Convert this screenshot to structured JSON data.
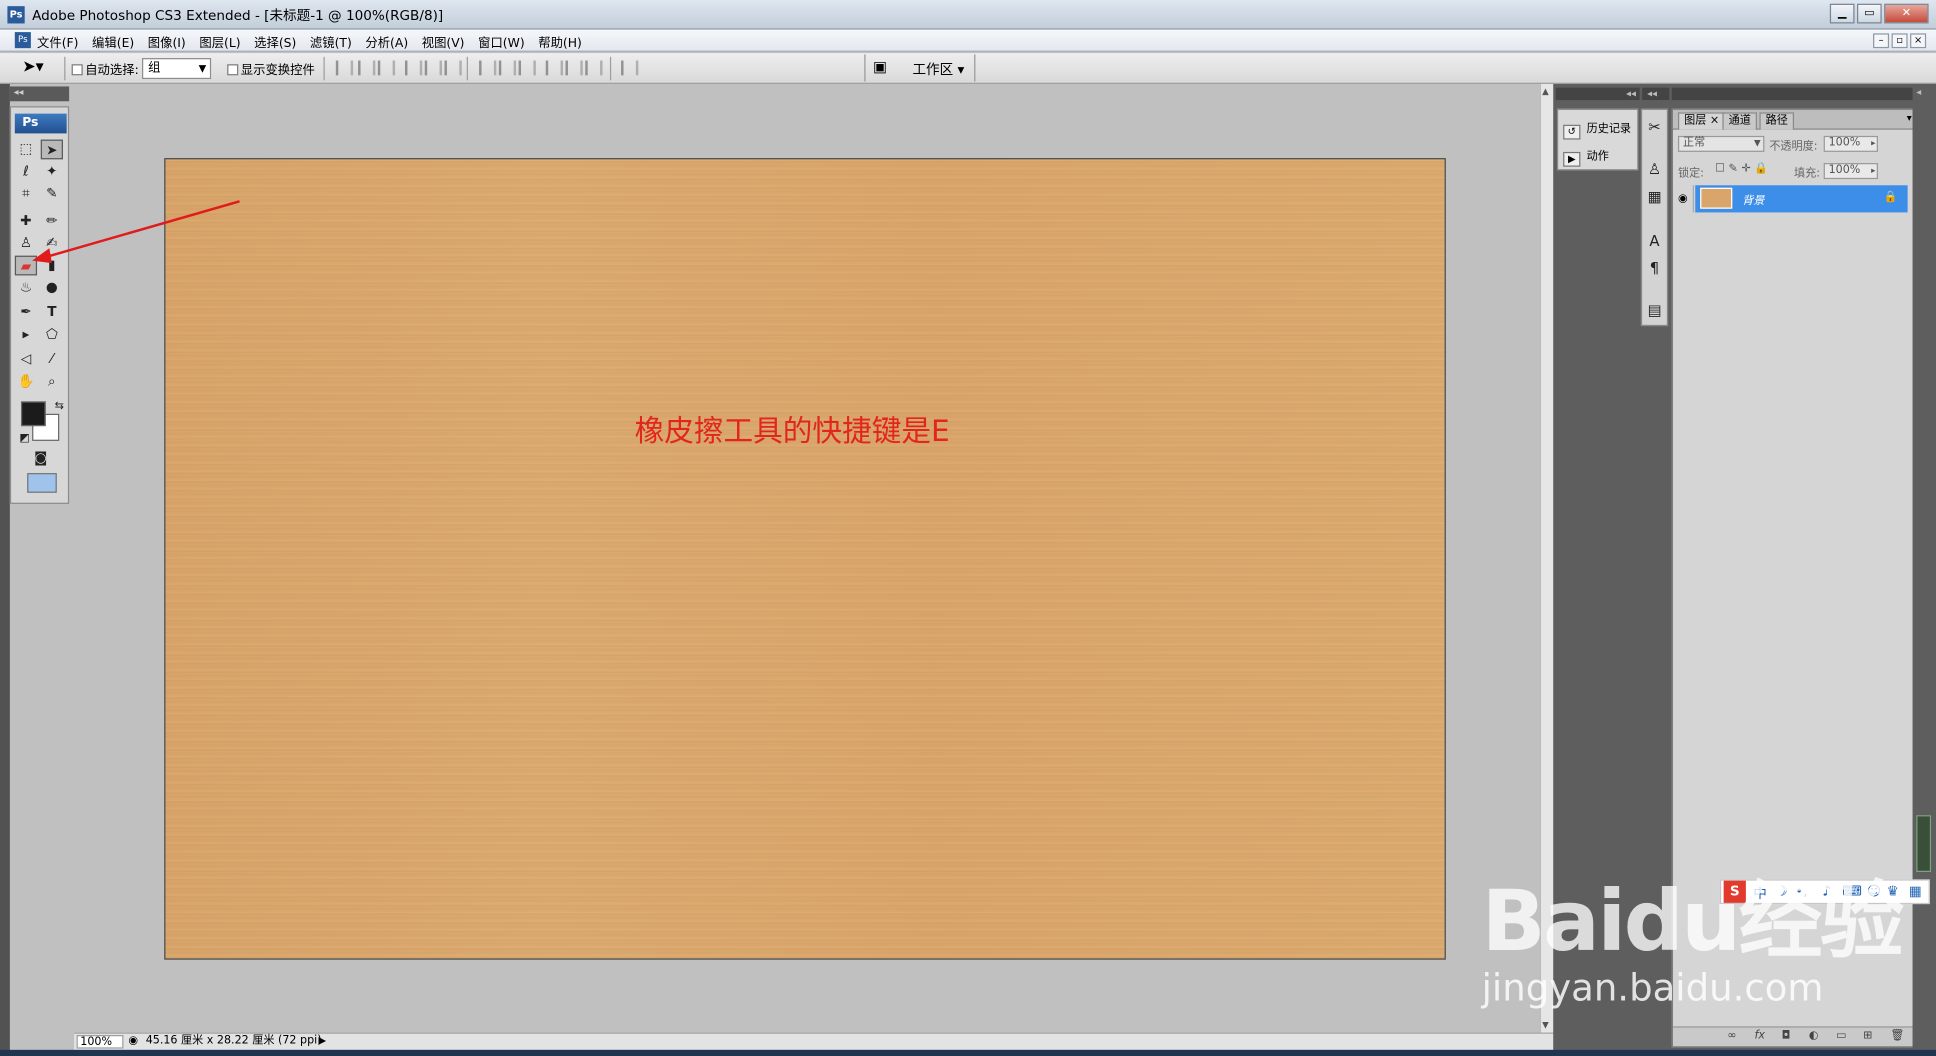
{
  "window": {
    "title": "Adobe Photoshop CS3 Extended - [未标题-1 @ 100%(RGB/8)]",
    "app_icon": "Ps"
  },
  "menu": {
    "items": [
      "文件(F)",
      "编辑(E)",
      "图像(I)",
      "图层(L)",
      "选择(S)",
      "滤镜(T)",
      "分析(A)",
      "视图(V)",
      "窗口(W)",
      "帮助(H)"
    ]
  },
  "options": {
    "auto_select_label": "自动选择:",
    "auto_select_value": "组",
    "show_transform_label": "显示变换控件",
    "workspace_label": "工作区"
  },
  "toolbox": {
    "logo": "Ps"
  },
  "canvas": {
    "annotation": "橡皮擦工具的快捷键是E",
    "annotation_color": "#e2251e",
    "fill_color": "#d9a56b"
  },
  "status": {
    "zoom": "100%",
    "doc_info": "45.16 厘米 x 28.22 厘米 (72 ppi)"
  },
  "history_panel": {
    "items": [
      "历史记录",
      "动作"
    ]
  },
  "layers_panel": {
    "tabs": [
      "图层",
      "通道",
      "路径"
    ],
    "blend_mode": "正常",
    "opacity_label": "不透明度:",
    "opacity_value": "100%",
    "lock_label": "锁定:",
    "fill_label": "填充:",
    "fill_value": "100%",
    "layers": [
      {
        "name": "背景",
        "locked": true,
        "visible": true
      }
    ]
  },
  "ime": {
    "items": [
      "S",
      "中"
    ]
  },
  "watermark": {
    "line1": "Baidu经验",
    "line2": "jingyan.baidu.com"
  }
}
